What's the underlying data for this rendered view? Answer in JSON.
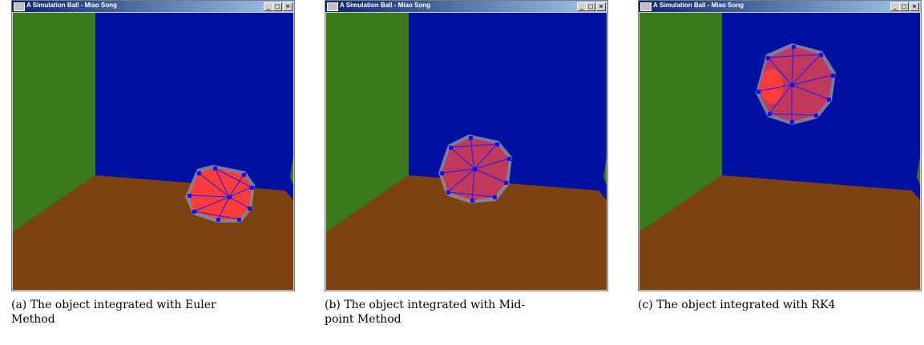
{
  "panels": [
    {
      "window_title": "A Simulation Ball - Miao Song",
      "caption": "(a) The object integrated with Euler\nMethod",
      "controls": {
        "minimize": "_",
        "maximize": "□",
        "close": "×"
      }
    },
    {
      "window_title": "A Simulation Ball - Miao Song",
      "caption": "(b) The object integrated with Mid-\npoint Method",
      "controls": {
        "minimize": "_",
        "maximize": "□",
        "close": "×"
      }
    },
    {
      "window_title": "A Simulation Ball - Miao Song",
      "caption": "(c) The object integrated with RK4",
      "controls": {
        "minimize": "_",
        "maximize": "□",
        "close": "×"
      }
    }
  ],
  "colors": {
    "back_wall": "#0010a0",
    "left_wall": "#3a7a1a",
    "floor": "#7c4211",
    "ball_fill": "#ff3c3c",
    "vertex": "#1010ff"
  }
}
